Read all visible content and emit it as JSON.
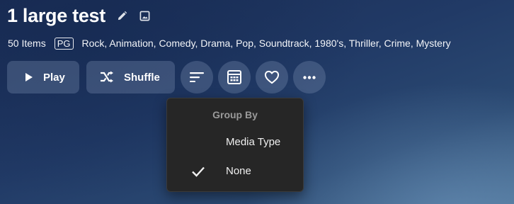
{
  "header": {
    "title": "1 large test",
    "icons": [
      "edit-pencil-icon",
      "image-icon"
    ]
  },
  "meta": {
    "item_count": "50 Items",
    "rating": "PG",
    "genres": "Rock, Animation, Comedy, Drama, Pop, Soundtrack, 1980's, Thriller, Crime, Mystery"
  },
  "actions": {
    "play_label": "Play",
    "shuffle_label": "Shuffle",
    "icons": [
      "play-icon",
      "shuffle-icon",
      "sort-icon",
      "calendar-grid-icon",
      "heart-icon",
      "more-icon"
    ]
  },
  "group_menu": {
    "header": "Group By",
    "items": [
      {
        "label": "Media Type",
        "checked": false
      },
      {
        "label": "None",
        "checked": true
      }
    ]
  },
  "colors": {
    "background": "#213a66",
    "button_bg": "rgba(120,140,175,0.35)",
    "menu_bg": "#262626",
    "menu_header": "#9a9a9a"
  }
}
